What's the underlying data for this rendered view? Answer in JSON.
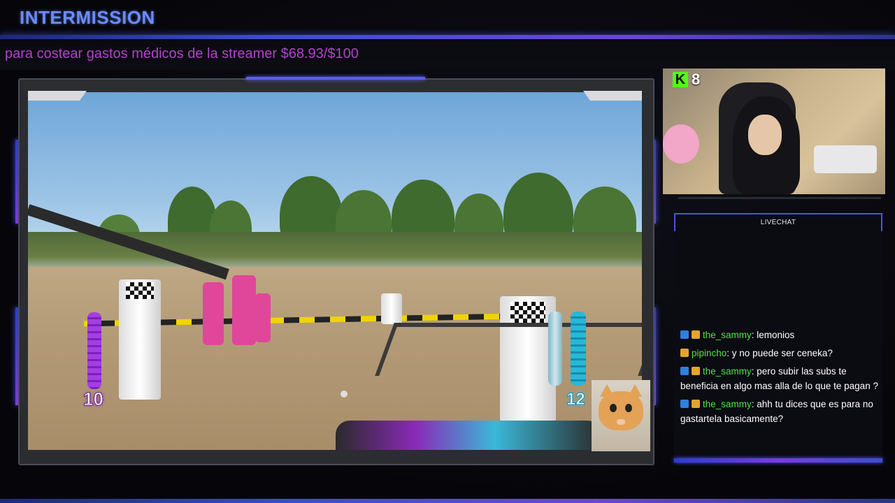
{
  "header": {
    "title": "INTERMISSION",
    "ticker": "para costear gastos médicos de la streamer $68.93/$100"
  },
  "game": {
    "score_left": "10",
    "score_right": "12"
  },
  "webcam": {
    "viewer_count": "8",
    "platform_icon": "kick-icon"
  },
  "chat": {
    "header": "LIVECHAT",
    "messages": [
      {
        "user": "the_sammy",
        "text": ": lemonios",
        "badges": [
          "blue",
          "gold"
        ]
      },
      {
        "user": "pipincho",
        "text": ": y no puede ser ceneka?",
        "badges": [
          "gold"
        ]
      },
      {
        "user": "the_sammy",
        "text": ": pero subir las subs te beneficia en algo mas alla de lo que te pagan ?",
        "badges": [
          "blue",
          "gold"
        ]
      },
      {
        "user": "the_sammy",
        "text": ": ahh tu dices que es para no gastartela basicamente?",
        "badges": [
          "blue",
          "gold"
        ]
      }
    ]
  },
  "colors": {
    "accent": "#4a55e0",
    "ticker": "#b045c8",
    "username": "#52e04a"
  }
}
